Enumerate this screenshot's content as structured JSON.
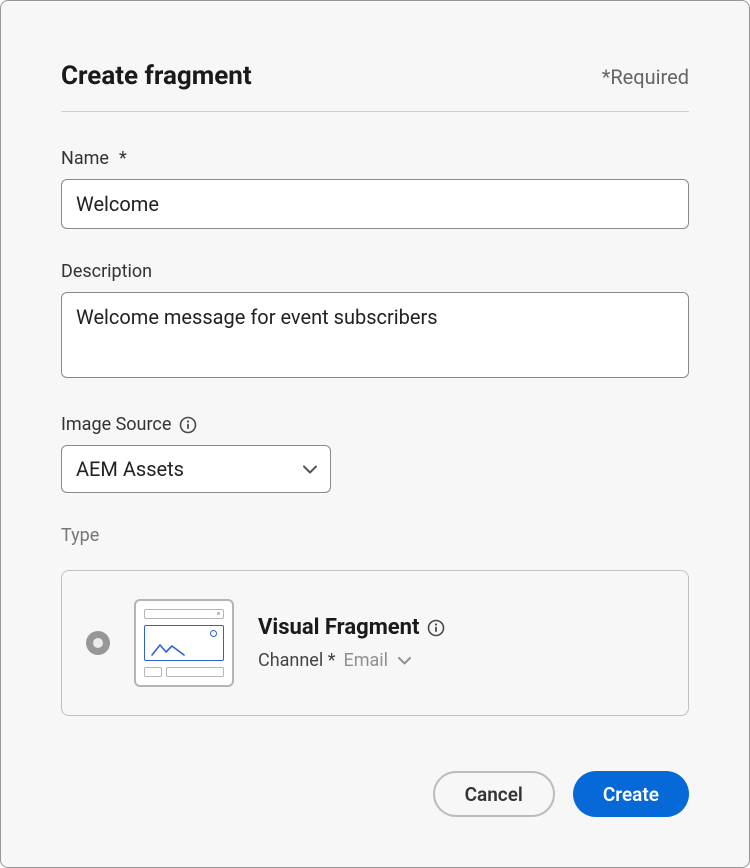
{
  "dialog": {
    "title": "Create fragment",
    "required_hint": "*Required"
  },
  "fields": {
    "name": {
      "label": "Name",
      "required_mark": "*",
      "value": "Welcome"
    },
    "description": {
      "label": "Description",
      "value": "Welcome message for event subscribers"
    },
    "image_source": {
      "label": "Image Source",
      "selected": "AEM Assets"
    },
    "type": {
      "section_label": "Type",
      "option": {
        "title": "Visual Fragment",
        "channel_label": "Channel",
        "channel_required": "*",
        "channel_value": "Email"
      }
    }
  },
  "buttons": {
    "cancel": "Cancel",
    "create": "Create"
  }
}
